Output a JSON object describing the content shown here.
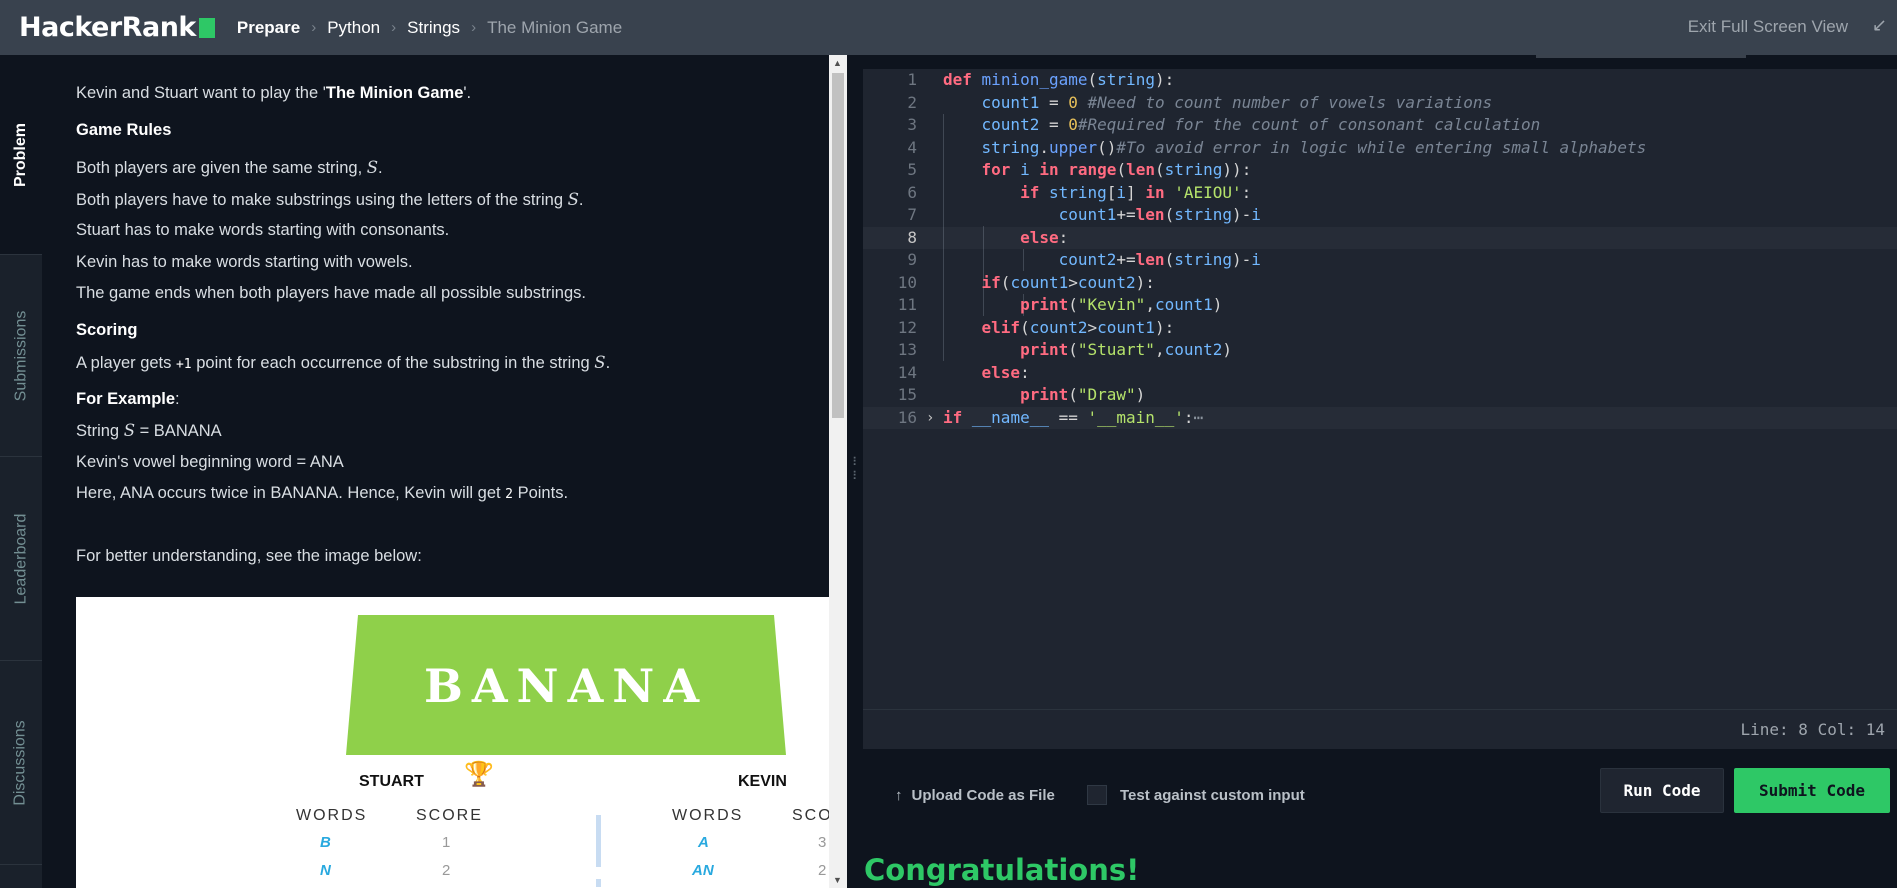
{
  "header": {
    "logo": "HackerRank",
    "breadcrumbs": [
      "Prepare",
      "Python",
      "Strings",
      "The Minion Game"
    ],
    "exit_label": "Exit Full Screen View"
  },
  "sidenav": {
    "tabs": [
      "Problem",
      "Submissions",
      "Leaderboard",
      "Discussions"
    ],
    "active": "Problem"
  },
  "problem": {
    "intro_pre": "Kevin and Stuart want to play the '",
    "intro_title": "The Minion Game",
    "intro_post": "'.",
    "rules_heading": "Game Rules",
    "rule1": "Both players are given the same string, ",
    "rule2": "Both players have to make substrings using the letters of the string ",
    "rule3": "Stuart has to make words starting with consonants.",
    "rule4": "Kevin has to make words starting with vowels.",
    "rule5": "The game ends when both players have made all possible substrings.",
    "math_s": "S",
    "period": ".",
    "scoring_heading": "Scoring",
    "scoring_pre": "A player gets ",
    "scoring_kbd": "+1",
    "scoring_post": " point for each occurrence of the substring in the string ",
    "example_heading": "For Example",
    "example_colon": ":",
    "example_string_pre": "String ",
    "example_string_post": " = BANANA",
    "example_vowel": "Kevin's vowel beginning word = ANA",
    "example_here_pre": "Here, ANA occurs twice in BANANA. Hence, Kevin will get ",
    "example_here_kbd": "2",
    "example_here_post": " Points.",
    "better": "For better understanding, see the image below:"
  },
  "figure": {
    "word": "BANANA",
    "stuart": "STUART",
    "kevin": "KEVIN",
    "words_header": "WORDS",
    "score_header": "SCORE",
    "score_header_cut": "SCO",
    "stuart_rows": [
      {
        "word": "B",
        "score": "1"
      },
      {
        "word": "N",
        "score": "2"
      }
    ],
    "kevin_rows": [
      {
        "word": "A",
        "score": "3"
      },
      {
        "word": "AN",
        "score": "2"
      }
    ],
    "trophy_color": "#e0a81c",
    "banner_color": "#8fd04a"
  },
  "editor": {
    "line_numbers": [
      "1",
      "2",
      "3",
      "4",
      "5",
      "6",
      "7",
      "8",
      "9",
      "10",
      "11",
      "12",
      "13",
      "14",
      "15",
      "16"
    ],
    "active_line": "8",
    "status": "Line: 8 Col: 14"
  },
  "actions": {
    "upload_label": "Upload Code as File",
    "custom_input_label": "Test against custom input",
    "run_label": "Run Code",
    "submit_label": "Submit Code"
  },
  "result": {
    "congrats": "Congratulations!"
  },
  "colors": {
    "accent": "#2ec866",
    "topbar": "#39424e",
    "background": "#0e141e"
  }
}
